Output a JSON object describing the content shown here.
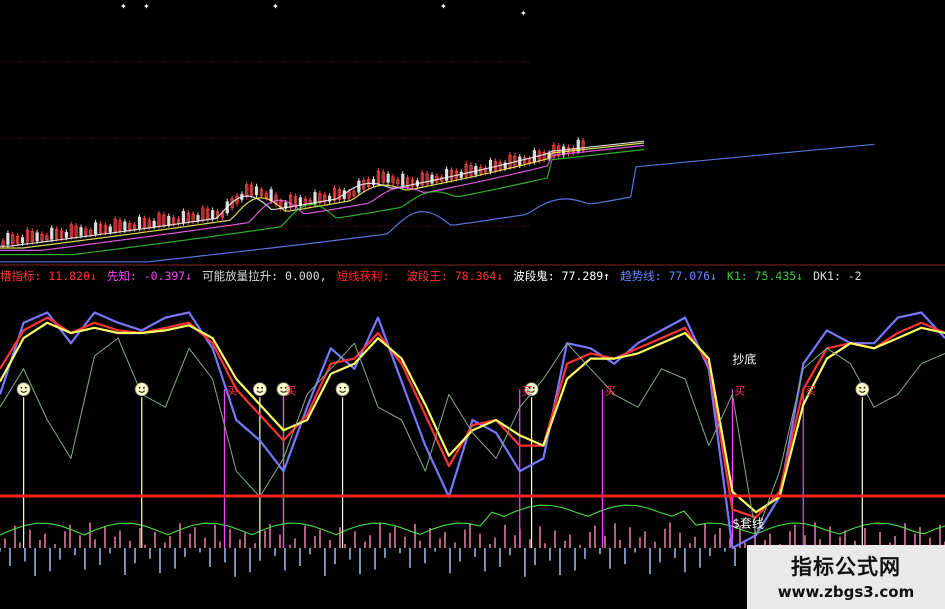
{
  "chart_data": {
    "type": "line",
    "indicators": [
      {
        "label": "槽指标:",
        "value": "11.820↓",
        "color": "#ff3333"
      },
      {
        "label": "先知:",
        "value": "-0.397↓",
        "color": "#ff44ff"
      },
      {
        "label": "可能放量拉升:",
        "value": "0.000,",
        "color": "#dddddd"
      },
      {
        "label": "短线获利:",
        "value": "",
        "color": "#ff2222"
      },
      {
        "label": "波段王:",
        "value": "78.364↓",
        "color": "#ff3333"
      },
      {
        "label": "波段鬼:",
        "value": "77.289↑",
        "color": "#ffffff"
      },
      {
        "label": "趋势线:",
        "value": "77.076↓",
        "color": "#6688ff"
      },
      {
        "label": "K1:",
        "value": "75.435↓",
        "color": "#33cc33"
      },
      {
        "label": "DK1:",
        "value": "-2",
        "color": "#dddddd"
      }
    ],
    "annotations": [
      {
        "text": "抄底",
        "x": 62,
        "y": 72
      },
      {
        "text": "$套线",
        "x": 62,
        "y": 8
      }
    ],
    "buy_labels": {
      "text": "买",
      "x": [
        19,
        24,
        44,
        51,
        62,
        68
      ]
    },
    "smileys": {
      "x": [
        2,
        12,
        22,
        24,
        29,
        45,
        73
      ],
      "y": 62
    },
    "osc_ylim": [
      0,
      100
    ],
    "oscillator": {
      "x": [
        0,
        2,
        4,
        6,
        8,
        10,
        12,
        14,
        16,
        18,
        20,
        22,
        24,
        26,
        28,
        30,
        32,
        34,
        36,
        38,
        40,
        42,
        44,
        46,
        48,
        50,
        52,
        54,
        56,
        58,
        60,
        62,
        64,
        66,
        68,
        70,
        72,
        74,
        76,
        78,
        80
      ],
      "series": [
        {
          "color": "#7777ff",
          "values": [
            60,
            88,
            92,
            80,
            92,
            88,
            85,
            90,
            92,
            78,
            50,
            42,
            30,
            55,
            78,
            70,
            90,
            65,
            40,
            20,
            50,
            45,
            30,
            35,
            80,
            78,
            72,
            80,
            85,
            90,
            70,
            0,
            5,
            20,
            72,
            85,
            80,
            80,
            90,
            92,
            82
          ]
        },
        {
          "color": "#ff3333",
          "values": [
            70,
            85,
            90,
            84,
            88,
            85,
            84,
            86,
            88,
            80,
            62,
            52,
            42,
            52,
            72,
            74,
            84,
            72,
            52,
            32,
            48,
            50,
            40,
            40,
            72,
            76,
            74,
            78,
            82,
            86,
            72,
            15,
            12,
            22,
            62,
            78,
            80,
            78,
            84,
            88,
            84
          ]
        },
        {
          "color": "#ffff66",
          "values": [
            65,
            82,
            88,
            84,
            86,
            84,
            84,
            85,
            87,
            82,
            66,
            56,
            46,
            50,
            68,
            72,
            82,
            74,
            56,
            36,
            46,
            50,
            44,
            40,
            66,
            74,
            74,
            76,
            80,
            84,
            74,
            22,
            14,
            20,
            56,
            74,
            80,
            78,
            82,
            86,
            84
          ]
        },
        {
          "color": "#88aa88",
          "values": [
            55,
            70,
            50,
            35,
            75,
            82,
            60,
            55,
            78,
            66,
            30,
            20,
            35,
            60,
            70,
            80,
            55,
            50,
            30,
            60,
            45,
            35,
            55,
            66,
            80,
            70,
            60,
            55,
            70,
            66,
            40,
            60,
            5,
            30,
            70,
            78,
            72,
            55,
            60,
            72,
            76
          ]
        }
      ]
    },
    "markers": {
      "values": [
        1,
        2
      ],
      "labels": [
        "抄底",
        "$套线"
      ]
    }
  },
  "watermark": {
    "title": "指标公式网",
    "url": "www.zbgs3.com"
  }
}
